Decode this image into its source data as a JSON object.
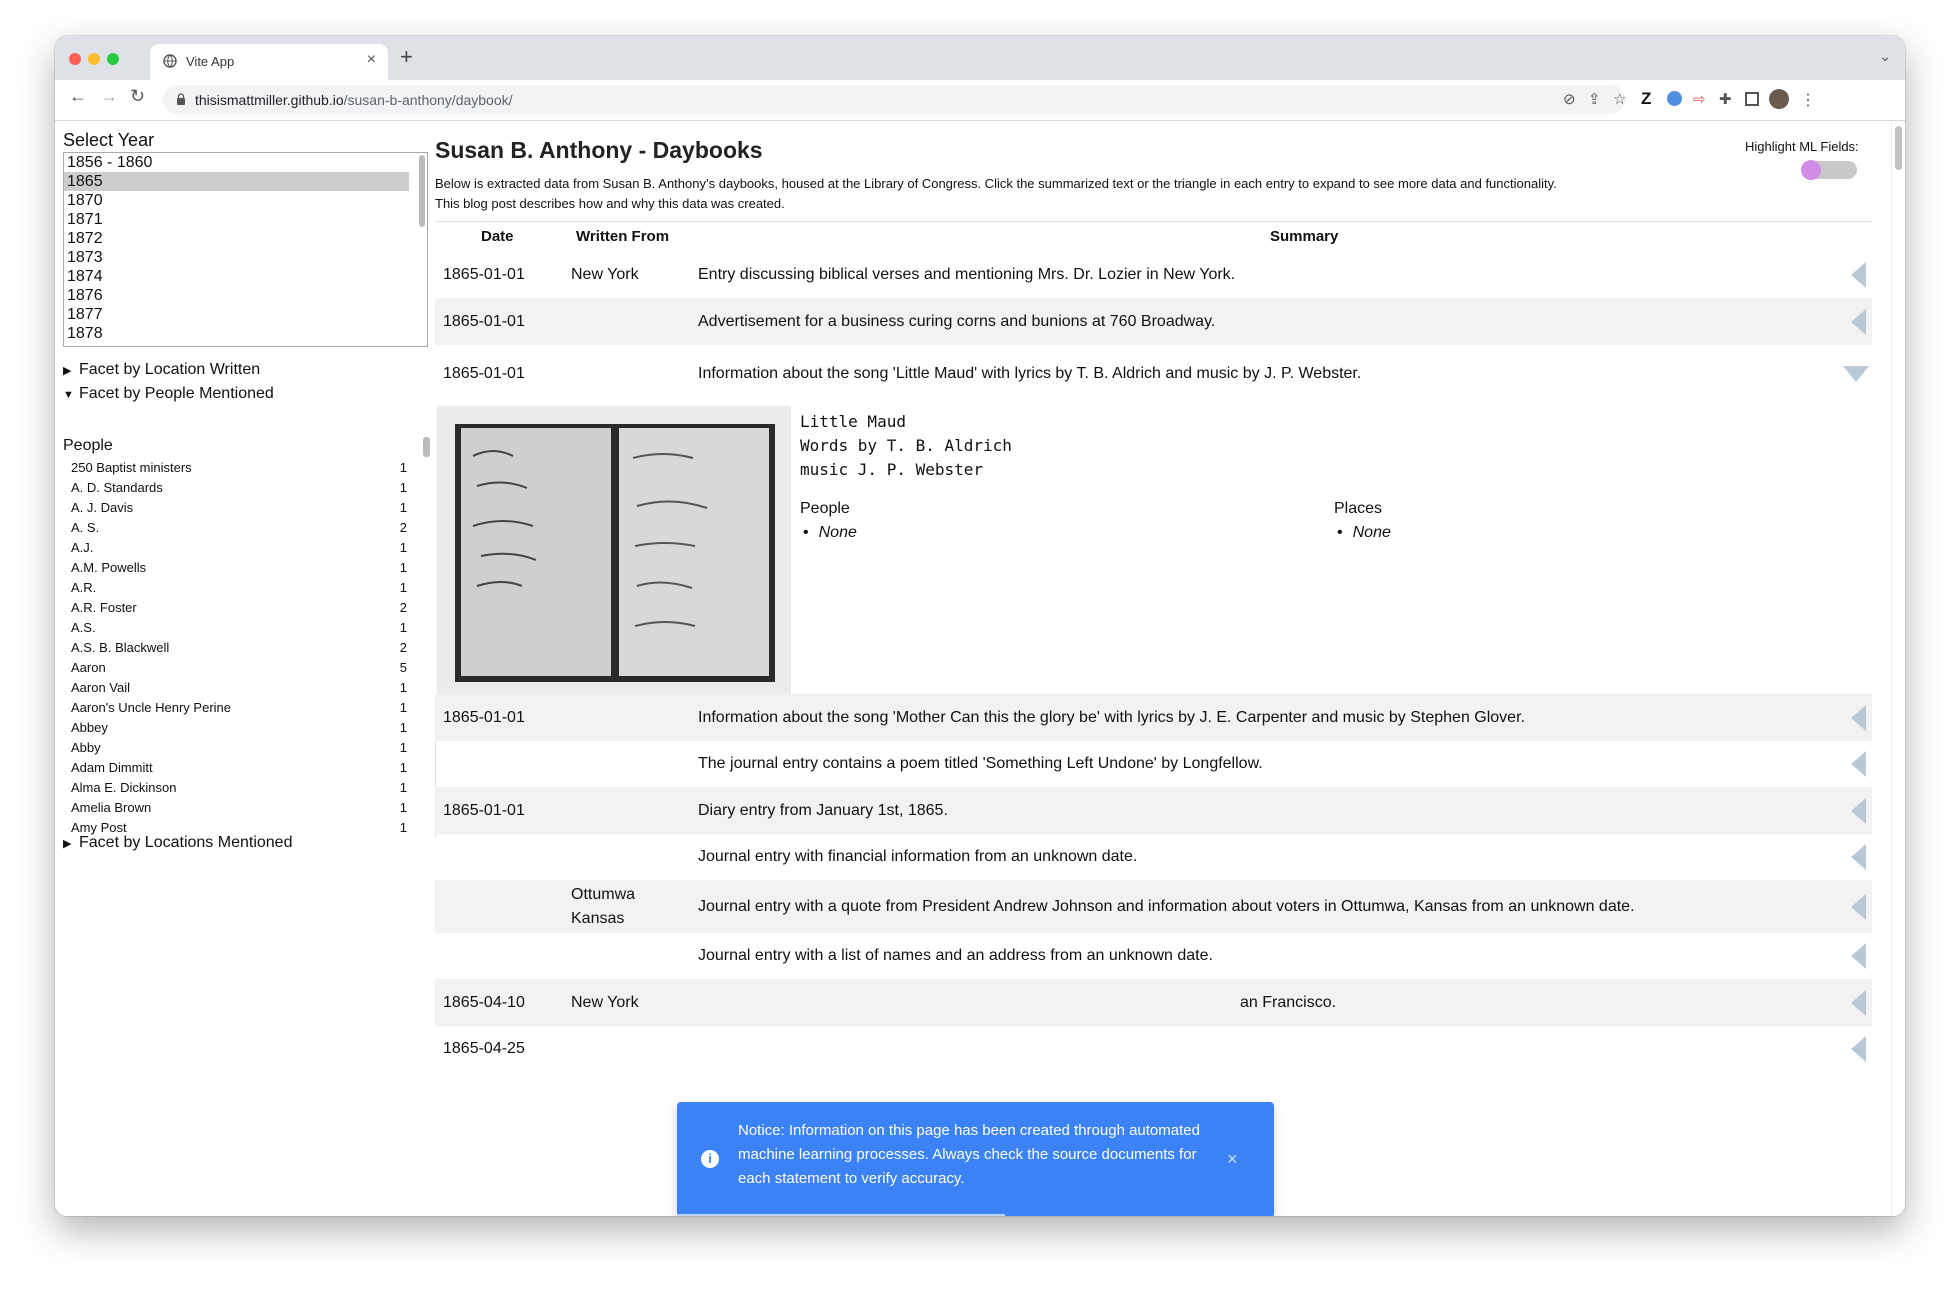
{
  "browser": {
    "tab_title": "Vite App",
    "url_host": "thisismattmiller.github.io",
    "url_path": "/susan-b-anthony/daybook/"
  },
  "sidebar": {
    "select_year_label": "Select Year",
    "years": [
      "1856 - 1860",
      "1865",
      "1870",
      "1871",
      "1872",
      "1873",
      "1874",
      "1876",
      "1877",
      "1878"
    ],
    "selected_year": "1865",
    "facet_location_written": "Facet by Location Written",
    "facet_people_mentioned": "Facet by People Mentioned",
    "people_heading": "People",
    "people": [
      {
        "name": "250 Baptist ministers",
        "count": "1"
      },
      {
        "name": "A. D. Standards",
        "count": "1"
      },
      {
        "name": "A. J. Davis",
        "count": "1"
      },
      {
        "name": "A. S.",
        "count": "2"
      },
      {
        "name": "A.J.",
        "count": "1"
      },
      {
        "name": "A.M. Powells",
        "count": "1"
      },
      {
        "name": "A.R.",
        "count": "1"
      },
      {
        "name": "A.R. Foster",
        "count": "2"
      },
      {
        "name": "A.S.",
        "count": "1"
      },
      {
        "name": "A.S. B. Blackwell",
        "count": "2"
      },
      {
        "name": "Aaron",
        "count": "5"
      },
      {
        "name": "Aaron Vail",
        "count": "1"
      },
      {
        "name": "Aaron's Uncle Henry Perine",
        "count": "1"
      },
      {
        "name": "Abbey",
        "count": "1"
      },
      {
        "name": "Abby",
        "count": "1"
      },
      {
        "name": "Adam Dimmitt",
        "count": "1"
      },
      {
        "name": "Alma E. Dickinson",
        "count": "1"
      },
      {
        "name": "Amelia Brown",
        "count": "1"
      },
      {
        "name": "Amy Post",
        "count": "1"
      }
    ],
    "facet_locations_mentioned": "Facet by Locations Mentioned"
  },
  "main": {
    "title": "Susan B. Anthony - Daybooks",
    "intro": "Below is extracted data from Susan B. Anthony’s daybooks, housed at the Library of Congress. Click the summarized text or the triangle in each entry to expand to see more data and functionality. This blog post describes how and why this data was created.",
    "highlight_label": "Highlight ML Fields:",
    "columns": {
      "date": "Date",
      "from": "Written From",
      "summary": "Summary"
    },
    "rows": [
      {
        "date": "1865-01-01",
        "from": "New York",
        "summary": "Entry discussing biblical verses and mentioning Mrs. Dr. Lozier in New York."
      },
      {
        "date": "1865-01-01",
        "from": "",
        "summary": "Advertisement for a business curing corns and bunions at 760 Broadway."
      },
      {
        "date": "1865-01-01",
        "from": "",
        "summary": "Information about the song 'Little Maud' with lyrics by T. B. Aldrich and music by J. P. Webster."
      },
      {
        "date": "1865-01-01",
        "from": "",
        "summary": "Information about the song 'Mother Can this the glory be' with lyrics by J. E. Carpenter and music by Stephen Glover."
      },
      {
        "date": "",
        "from": "",
        "summary": "The journal entry contains a poem titled 'Something Left Undone' by Longfellow."
      },
      {
        "date": "1865-01-01",
        "from": "",
        "summary": "Diary entry from January 1st, 1865."
      },
      {
        "date": "",
        "from": "",
        "summary": "Journal entry with financial information from an unknown date."
      },
      {
        "date": "",
        "from": "Ottumwa Kansas",
        "summary": "Journal entry with a quote from President Andrew Johnson and information about voters in Ottumwa, Kansas from an unknown date."
      },
      {
        "date": "",
        "from": "",
        "summary": "Journal entry with a list of names and an address from an unknown date."
      },
      {
        "date": "1865-04-10",
        "from": "New York",
        "summary": "an Francisco."
      },
      {
        "date": "1865-04-25",
        "from": "",
        "summary": ""
      }
    ],
    "expanded_entry": {
      "lyrics": [
        "Little Maud",
        "Words by T. B. Aldrich",
        "music J. P. Webster"
      ],
      "people_label": "People",
      "people_value": "None",
      "places_label": "Places",
      "places_value": "None"
    }
  },
  "toast": {
    "message": "Notice: Information on this page has been created through automated machine learning processes. Always check the source documents for each statement to verify accuracy.",
    "close_symbol": "×",
    "info_symbol": "i"
  },
  "colors": {
    "toast_bg": "#3b82f6",
    "toggle_knob": "#d18ce3",
    "row_shade": "#f2f2f2",
    "arrow": "#b9c8d6"
  }
}
